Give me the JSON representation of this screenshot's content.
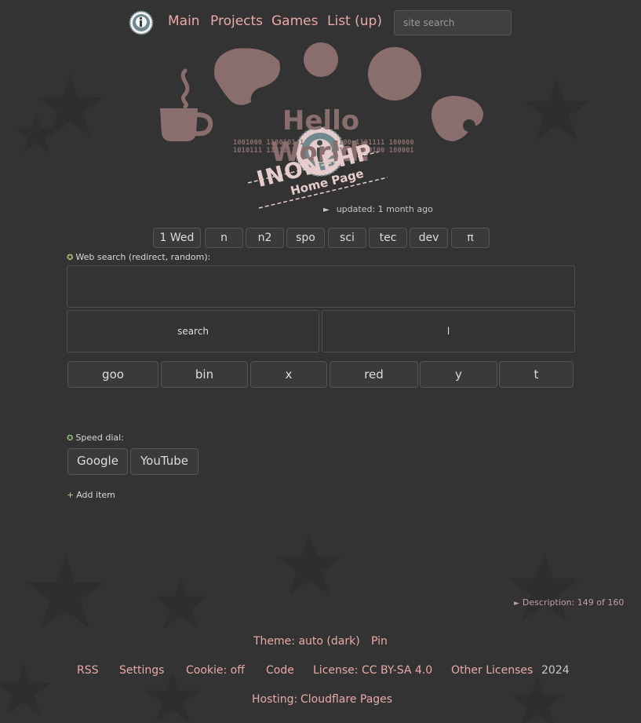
{
  "nav": {
    "links": [
      "Main",
      "Projects",
      "Games",
      "List (up)"
    ],
    "search_placeholder": "site search"
  },
  "hero": {
    "title": "Hello World!",
    "binary_left": [
      "1001000 1100101 1",
      "1010111 1101111"
    ],
    "binary_right": [
      "100 1101111 100000",
      "100 1100100 100001"
    ],
    "stamp_name": "INONEHP",
    "stamp_sub": "Home Page"
  },
  "updated": {
    "arrow": "►",
    "text": "updated: 1 month ago"
  },
  "tabs": [
    "1 Wed",
    "n",
    "n2",
    "spo",
    "sci",
    "tec",
    "dev",
    "π"
  ],
  "web_search": {
    "label": "Web search (redirect, random):",
    "input_value": "",
    "search_button": "search",
    "lucky_button": "l",
    "engines": [
      "goo",
      "bin",
      "x",
      "red",
      "y",
      "t"
    ]
  },
  "speed_dial": {
    "label": "Speed dial:",
    "items": [
      "Google",
      "YouTube"
    ],
    "add_item": "Add item"
  },
  "description": {
    "arrow": "►",
    "text": "Description: 149 of 160"
  },
  "footer": {
    "theme": "Theme: auto (dark)",
    "pin": "Pin",
    "rss": "RSS",
    "settings": "Settings",
    "cookie": "Cookie: off",
    "code": "Code",
    "license": "License: CC BY-SA 4.0",
    "other_licenses": "Other Licenses",
    "year": "2024",
    "hosting_label": "Hosting:",
    "hosting_value": "Cloudflare Pages"
  },
  "colors": {
    "background": "#333333",
    "link": "#e8aaa8",
    "hero_shape": "#8a6e6d",
    "text": "#dddddd"
  },
  "icons": {
    "logo": "inonehp-logo-icon",
    "updated_arrow": "triangle-right-icon",
    "section_marker": "star-badge-icon",
    "add": "plus-icon"
  }
}
